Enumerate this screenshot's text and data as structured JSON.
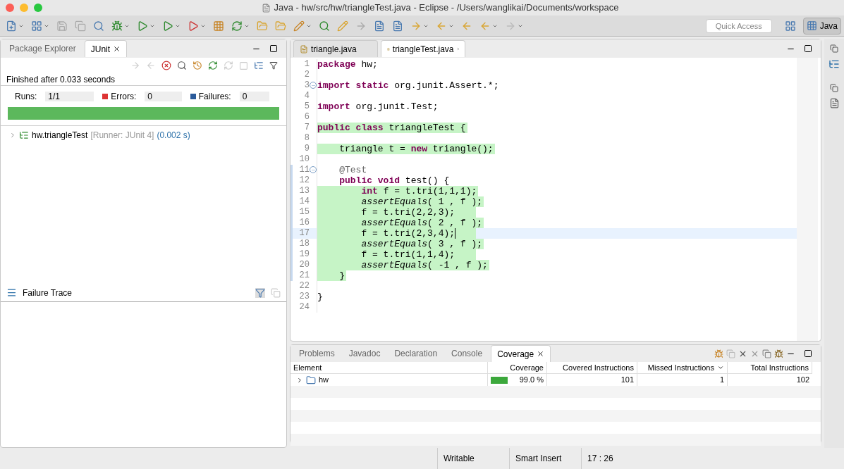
{
  "window": {
    "title": "Java - hw/src/hw/triangleTest.java - Eclipse - /Users/wanglikai/Documents/workspace"
  },
  "toolbar": {
    "quick_access": {
      "placeholder": "Quick Access"
    },
    "perspective": {
      "label": "Java",
      "selected": true
    }
  },
  "left_panel": {
    "tabs": [
      {
        "label": "Package Explorer",
        "selected": false
      },
      {
        "label": "JUnit",
        "selected": true
      }
    ],
    "status": "Finished after 0.033 seconds",
    "counters": [
      {
        "label": "Runs:",
        "value": "1/1",
        "kind": "runs"
      },
      {
        "label": "Errors:",
        "value": "0",
        "kind": "errors"
      },
      {
        "label": "Failures:",
        "value": "0",
        "kind": "failures"
      }
    ],
    "progress": {
      "level": 1
    },
    "tree": [
      {
        "name": "hw.triangleTest",
        "runner": "[Runner: JUnit 4]",
        "time": "(0.002 s)",
        "expanded": false
      }
    ],
    "failure_trace": {
      "title": "Failure Trace"
    }
  },
  "editor": {
    "tabs": [
      {
        "label": "triangle.java",
        "selected": false
      },
      {
        "label": "triangleTest.java",
        "selected": true
      }
    ],
    "lines": [
      {
        "number": "1",
        "covered": false,
        "current": false,
        "fold": false,
        "tokens": [
          {
            "text": "package",
            "kind": "keyword"
          },
          {
            "text": " hw;",
            "kind": "plain"
          }
        ]
      },
      {
        "number": "2",
        "covered": false,
        "current": false,
        "fold": false
      },
      {
        "number": "3",
        "covered": false,
        "current": false,
        "fold": true,
        "tokens": [
          {
            "text": "import static",
            "kind": "keyword"
          },
          {
            "text": " org.junit.Assert.*;",
            "kind": "plain"
          }
        ]
      },
      {
        "number": "4",
        "covered": false,
        "current": false,
        "fold": false
      },
      {
        "number": "5",
        "covered": false,
        "current": false,
        "fold": false,
        "tokens": [
          {
            "text": "import",
            "kind": "keyword"
          },
          {
            "text": " org.junit.Test;",
            "kind": "plain"
          }
        ]
      },
      {
        "number": "6",
        "covered": false,
        "current": false,
        "fold": false
      },
      {
        "number": "7",
        "covered": true,
        "current": false,
        "fold": false,
        "tokens": [
          {
            "text": "public class",
            "kind": "keyword"
          },
          {
            "text": " triangleTest {",
            "kind": "plain"
          }
        ]
      },
      {
        "number": "8",
        "covered": false,
        "current": false,
        "fold": false
      },
      {
        "number": "9",
        "covered": true,
        "current": false,
        "fold": false,
        "tokens": [
          {
            "text": "    triangle t = ",
            "kind": "plain"
          },
          {
            "text": "new",
            "kind": "keyword"
          },
          {
            "text": " triangle();",
            "kind": "plain"
          }
        ]
      },
      {
        "number": "10",
        "covered": false,
        "current": false,
        "fold": false
      },
      {
        "number": "11",
        "covered": false,
        "current": false,
        "fold": true,
        "tokens": [
          {
            "text": "    @Test",
            "kind": "annotation"
          }
        ]
      },
      {
        "number": "12",
        "covered": false,
        "current": false,
        "fold": false,
        "tokens": [
          {
            "text": "    public void",
            "kind": "keyword"
          },
          {
            "text": " test() {",
            "kind": "plain"
          }
        ]
      },
      {
        "number": "13",
        "covered": true,
        "current": false,
        "fold": false,
        "tokens": [
          {
            "text": "        int",
            "kind": "keyword"
          },
          {
            "text": " f = t.tri(1,1,1);",
            "kind": "plain"
          }
        ]
      },
      {
        "number": "14",
        "covered": true,
        "current": false,
        "fold": false,
        "tokens": [
          {
            "text": "        assertEquals",
            "kind": "static"
          },
          {
            "text": "( 1 , f );",
            "kind": "plain"
          }
        ]
      },
      {
        "number": "15",
        "covered": true,
        "current": false,
        "fold": false,
        "tokens": [
          {
            "text": "        f = t.tri(2,2,3);",
            "kind": "plain"
          }
        ]
      },
      {
        "number": "16",
        "covered": true,
        "current": false,
        "fold": false,
        "tokens": [
          {
            "text": "        assertEquals",
            "kind": "static"
          },
          {
            "text": "( 2 , f );",
            "kind": "plain"
          }
        ]
      },
      {
        "number": "17",
        "covered": true,
        "current": true,
        "fold": false,
        "tokens": [
          {
            "text": "        f = t.tri(2,3,4);",
            "kind": "plain"
          }
        ]
      },
      {
        "number": "18",
        "covered": true,
        "current": false,
        "fold": false,
        "tokens": [
          {
            "text": "        assertEquals",
            "kind": "static"
          },
          {
            "text": "( 3 , f );",
            "kind": "plain"
          }
        ]
      },
      {
        "number": "19",
        "covered": true,
        "current": false,
        "fold": false,
        "tokens": [
          {
            "text": "        f = t.tri(1,1,4);",
            "kind": "plain"
          }
        ]
      },
      {
        "number": "20",
        "covered": true,
        "current": false,
        "fold": false,
        "tokens": [
          {
            "text": "        assertEquals",
            "kind": "static"
          },
          {
            "text": "( -1 , f );",
            "kind": "plain"
          }
        ]
      },
      {
        "number": "21",
        "covered": true,
        "current": false,
        "fold": false,
        "tokens": [
          {
            "text": "    }",
            "kind": "plain"
          }
        ]
      },
      {
        "number": "22",
        "covered": false,
        "current": false,
        "fold": false
      },
      {
        "number": "23",
        "covered": false,
        "current": false,
        "fold": false,
        "tokens": [
          {
            "text": "}",
            "kind": "plain"
          }
        ]
      },
      {
        "number": "24",
        "covered": false,
        "current": false,
        "fold": false
      }
    ]
  },
  "bottom_panel": {
    "tabs": [
      {
        "label": "Problems",
        "selected": false
      },
      {
        "label": "Javadoc",
        "selected": false
      },
      {
        "label": "Declaration",
        "selected": false
      },
      {
        "label": "Console",
        "selected": false
      },
      {
        "label": "Coverage",
        "selected": true
      }
    ],
    "columns": [
      {
        "label": "Element",
        "sorted": false
      },
      {
        "label": "Coverage",
        "sorted": false
      },
      {
        "label": "Covered Instructions",
        "sorted": false
      },
      {
        "label": "Missed Instructions",
        "sorted": true
      },
      {
        "label": "Total Instructions",
        "sorted": false
      }
    ],
    "rows": [
      {
        "element": "hw",
        "expanded": false,
        "level": 0.99,
        "coverage": "99.0 %",
        "covered": "101",
        "missed": "1",
        "total": "102"
      }
    ]
  },
  "status_bar": [
    "Writable",
    "Smart Insert",
    "17 : 26"
  ]
}
